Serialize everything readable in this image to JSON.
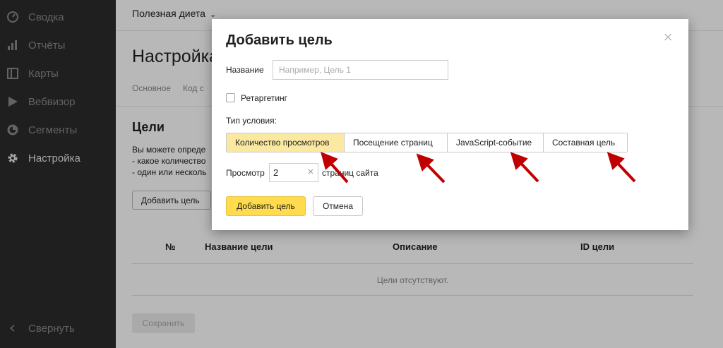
{
  "sidebar": {
    "items": [
      {
        "label": "Сводка",
        "icon": "dashboard-icon"
      },
      {
        "label": "Отчёты",
        "icon": "bar-chart-icon"
      },
      {
        "label": "Карты",
        "icon": "map-icon"
      },
      {
        "label": "Вебвизор",
        "icon": "play-icon"
      },
      {
        "label": "Сегменты",
        "icon": "segments-icon"
      },
      {
        "label": "Настройка",
        "icon": "gear-icon",
        "active": true
      }
    ],
    "collapse_label": "Свернуть"
  },
  "main": {
    "counter_title": "Полезная диета",
    "page_title": "Настройка",
    "tabs": [
      "Основное",
      "Код с"
    ],
    "goals_title": "Цели",
    "goals_desc": [
      "Вы можете опреде",
      "- какое количество",
      "- один или несколь"
    ],
    "add_goal_label": "Добавить цель",
    "table": {
      "headers": {
        "num": "№",
        "name": "Название цели",
        "description": "Описание",
        "id": "ID цели"
      },
      "empty": "Цели отсутствуют."
    },
    "save_label": "Сохранить"
  },
  "modal": {
    "title": "Добавить цель",
    "name_label": "Название",
    "name_placeholder": "Например, Цель 1",
    "retargeting_label": "Ретаргетинг",
    "condition_label": "Тип условия:",
    "condition_types": [
      "Количество просмотров",
      "Посещение страниц",
      "JavaScript-событие",
      "Составная цель"
    ],
    "selected_condition": "Количество просмотров",
    "views_label": "Просмотр",
    "views_value": "2",
    "views_suffix": "страниц сайта",
    "submit_label": "Добавить цель",
    "cancel_label": "Отмена"
  },
  "colors": {
    "sidebar_bg": "#2b2b2b",
    "selected_segment": "#fbe9a1",
    "primary_button": "#ffdb4d",
    "annotation_arrow": "#c00000"
  }
}
